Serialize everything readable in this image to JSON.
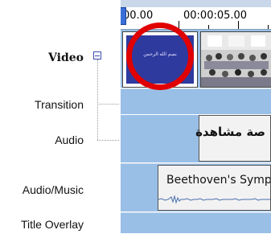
{
  "tracks": {
    "video": "Video",
    "transition": "Transition",
    "audio": "Audio",
    "audio_music": "Audio/Music",
    "title_overlay": "Title Overlay"
  },
  "ruler": {
    "time_start": "00.00",
    "time_mark": "00:00:05.00"
  },
  "clips": {
    "video_thumb_title": "بسم الله الرحمن",
    "audio_clip_text": "صة مشاهدة",
    "music_clip_text": "Beethoven's Symp"
  },
  "colors": {
    "track_bg": "#99bfe6",
    "highlight_ring": "#e00000",
    "playhead": "#3a6fd8",
    "video_thumb": "#2f3a9e"
  },
  "icons": {
    "collapse": "collapse-minus-icon",
    "playhead": "playhead-icon"
  }
}
